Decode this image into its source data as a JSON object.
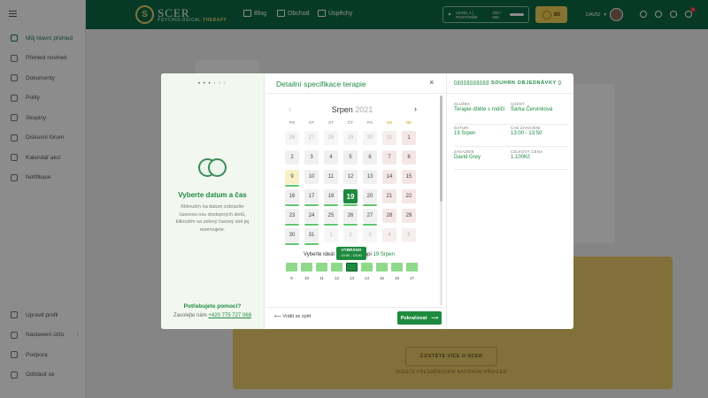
{
  "app": {
    "logo": {
      "mark": "S",
      "name": "SCER",
      "tagline_a": "PSYCHOLOGICAL",
      "tagline_b": "THERAPY"
    },
    "topnav": [
      {
        "label": "Blog",
        "icon": "blog-icon"
      },
      {
        "label": "Obchod",
        "icon": "cart-icon"
      },
      {
        "label": "Úspěchy",
        "icon": "person-icon"
      }
    ],
    "level": {
      "label": "LEVEL 1 | POSTONŽE",
      "progress_text": "200 / 500",
      "progress": 0.4
    },
    "coins": "80",
    "user": "DAVID",
    "cart_count": "3",
    "sidebar": [
      {
        "label": "Můj hlavní přehled",
        "icon": "dashboard-icon",
        "active": true
      },
      {
        "label": "Přehled novinek",
        "icon": "activity-icon"
      },
      {
        "label": "Dokumenty",
        "icon": "cloud-icon"
      },
      {
        "label": "Polity",
        "icon": "box-icon"
      },
      {
        "label": "Skupiny",
        "icon": "people-icon"
      },
      {
        "label": "Diskusní fórum",
        "icon": "chat-icon"
      },
      {
        "label": "Kalendář akcí",
        "icon": "calendar-icon"
      },
      {
        "label": "Notifikace",
        "icon": "bell-icon"
      }
    ],
    "sidebar_bottom": [
      {
        "label": "Upravit profil",
        "icon": "user-edit-icon"
      },
      {
        "label": "Nastavení účtu",
        "icon": "settings-icon"
      },
      {
        "label": "Podpora",
        "icon": "shield-icon"
      },
      {
        "label": "Odhlásit se",
        "icon": "logout-icon"
      }
    ],
    "promo": {
      "button": "ZJISTĚTE VÍCE O SCER",
      "sub": "BUDETE PŘESMĚROVÁNI NASTÍAVNI PŘEHLED"
    }
  },
  "modal": {
    "step_dots": "• • • ",
    "step_dots_off": "• • •",
    "left": {
      "title": "Vyberte datum a čas",
      "text": "Kliknutím na datum zobrazíte časovou osu dostupných slotů, kliknutím na zelený časový slot jej rezervujete.",
      "help": "Potřebujete pomoci?",
      "contact_prefix": "Zavolejte nám",
      "phone": "+420 775 727 068"
    },
    "title": "Detailní specifikace terapie",
    "close": "×",
    "calendar": {
      "month": "Srpen",
      "year": "2021",
      "weekdays": [
        "PO",
        "ÚT",
        "ST",
        "ČT",
        "PÁ",
        "SO",
        "NE"
      ],
      "weeks": [
        [
          "26",
          "27",
          "28",
          "29",
          "30",
          "31",
          "1"
        ],
        [
          "2",
          "3",
          "4",
          "5",
          "6",
          "7",
          "8"
        ],
        [
          "9",
          "10",
          "11",
          "12",
          "13",
          "14",
          "15"
        ],
        [
          "16",
          "17",
          "18",
          "19",
          "20",
          "21",
          "22"
        ],
        [
          "23",
          "24",
          "25",
          "26",
          "27",
          "28",
          "29"
        ],
        [
          "30",
          "31",
          "1",
          "2",
          "3",
          "4",
          "5"
        ]
      ],
      "selected_day": "19"
    },
    "slots": {
      "label_prefix": "Vyberte ideál",
      "label_mid": "api",
      "label_date": "19 Srpen",
      "tip_title": "VYBRÁNO",
      "tip_time": "13:00 - 13:50",
      "hours": [
        "9",
        "10",
        "11",
        "12",
        "13",
        "14",
        "15",
        "16",
        "17"
      ],
      "selected_hour": "13"
    },
    "back_label": "Vrátit se zpět",
    "continue_label": "Pokračovat",
    "summary": {
      "title": "SOUHRN OBJEDNÁVKY",
      "items": [
        {
          "key": "SLUŽBA",
          "value": "Terapie dítěte s rodiči"
        },
        {
          "key": "AGENT",
          "value": "Šárka Červinková"
        },
        {
          "key": "DATUM",
          "value": "19 Srpen"
        },
        {
          "key": "ČAS ZAHÁJENÍ",
          "value": "13:00 - 13:50"
        },
        {
          "key": "ZÁKAZNÍK",
          "value": "David Grey"
        },
        {
          "key": "CELKOVÁ CENA",
          "value": "1.100Kč"
        }
      ]
    }
  },
  "colors": {
    "primary": "#0b6b45",
    "accent": "#1e8a45",
    "gold": "#f4d25a"
  }
}
